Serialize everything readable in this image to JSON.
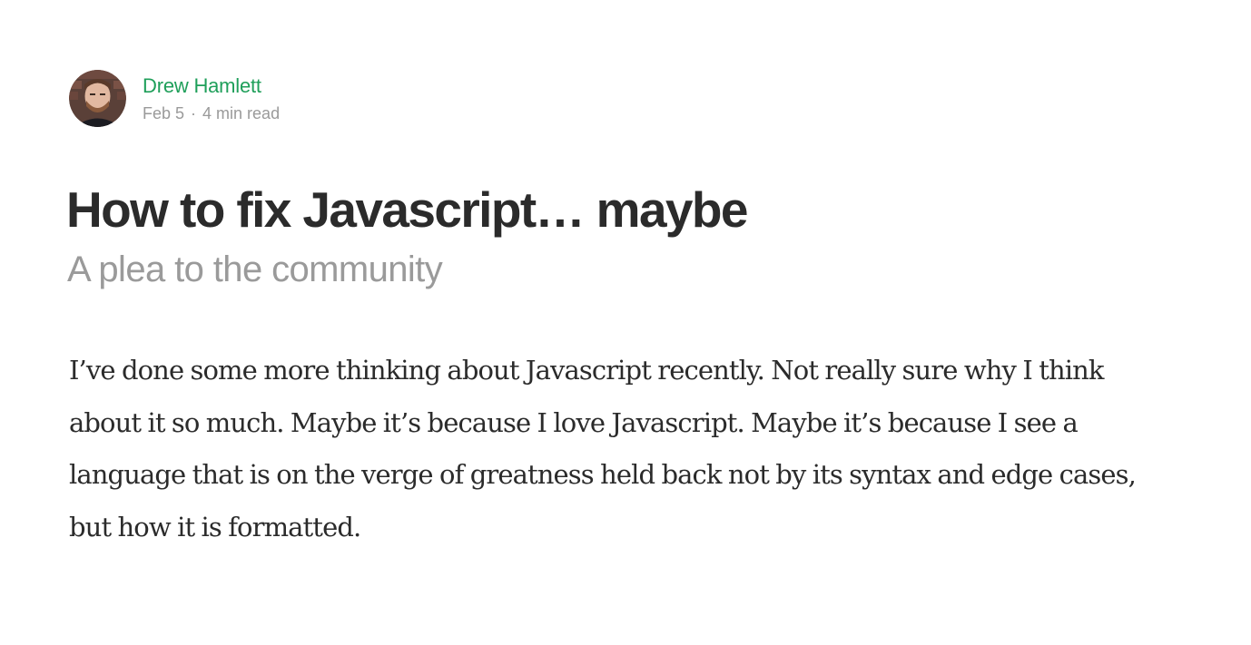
{
  "article": {
    "author": {
      "name": "Drew Hamlett",
      "avatar_icon": "author-avatar-photo"
    },
    "date": "Feb 5",
    "separator": "·",
    "read_time": "4 min read",
    "title": "How to fix Javascript… maybe",
    "subtitle": "A plea to the community",
    "body": "I’ve done some more thinking about Javascript recently. Not really sure why I think about it so much. Maybe it’s because I love Javascript. Maybe it’s because I see a language that is on the verge of greatness held back not by its syntax and edge cases, but how it is formatted."
  },
  "colors": {
    "author_link": "#1f9f5a",
    "title": "#2b2b2b",
    "muted": "#9a9a9a",
    "body": "#2b2b2b"
  }
}
